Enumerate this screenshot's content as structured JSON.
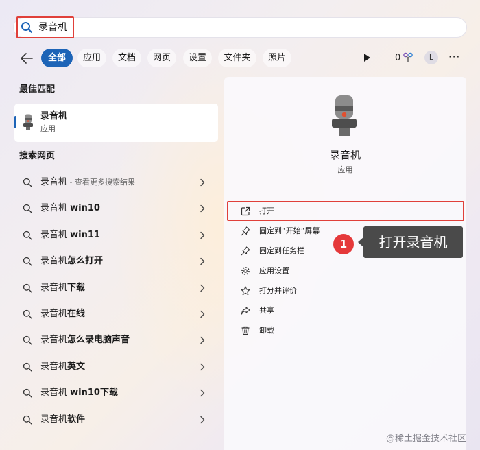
{
  "search": {
    "query": "录音机"
  },
  "filters": [
    {
      "label": "全部",
      "active": true
    },
    {
      "label": "应用"
    },
    {
      "label": "文档"
    },
    {
      "label": "网页"
    },
    {
      "label": "设置"
    },
    {
      "label": "文件夹"
    },
    {
      "label": "照片"
    }
  ],
  "header_right": {
    "rewards_count": "0",
    "avatar_initial": "L",
    "more": "···"
  },
  "best_match": {
    "section_title": "最佳匹配",
    "app_name": "录音机",
    "app_type": "应用"
  },
  "web_search": {
    "section_title": "搜索网页",
    "items": [
      {
        "prefix": "录音机",
        "bold": "",
        "sub": " - 查看更多搜索结果"
      },
      {
        "prefix": "录音机 ",
        "bold": "win10",
        "sub": ""
      },
      {
        "prefix": "录音机 ",
        "bold": "win11",
        "sub": ""
      },
      {
        "prefix": "录音机",
        "bold": "怎么打开",
        "sub": ""
      },
      {
        "prefix": "录音机",
        "bold": "下载",
        "sub": ""
      },
      {
        "prefix": "录音机",
        "bold": "在线",
        "sub": ""
      },
      {
        "prefix": "录音机",
        "bold": "怎么录电脑声音",
        "sub": ""
      },
      {
        "prefix": "录音机",
        "bold": "英文",
        "sub": ""
      },
      {
        "prefix": "录音机 ",
        "bold": "win10下载",
        "sub": ""
      },
      {
        "prefix": "录音机",
        "bold": "软件",
        "sub": ""
      }
    ]
  },
  "detail_panel": {
    "app_name": "录音机",
    "app_type": "应用",
    "actions": [
      {
        "label": "打开",
        "icon": "open-external-icon"
      },
      {
        "label": "固定到“开始”屏幕",
        "icon": "pin-icon"
      },
      {
        "label": "固定到任务栏",
        "icon": "pin-icon"
      },
      {
        "label": "应用设置",
        "icon": "gear-icon"
      },
      {
        "label": "打分并评价",
        "icon": "star-icon"
      },
      {
        "label": "共享",
        "icon": "share-icon"
      },
      {
        "label": "卸载",
        "icon": "trash-icon"
      }
    ]
  },
  "annotation": {
    "step_number": "1",
    "text": "打开录音机"
  },
  "watermark": "@稀土掘金技术社区",
  "colors": {
    "accent": "#1d64b7",
    "highlight_border": "#e0403a",
    "badge": "#e5393a",
    "callout_bg": "#4a4a4a"
  }
}
